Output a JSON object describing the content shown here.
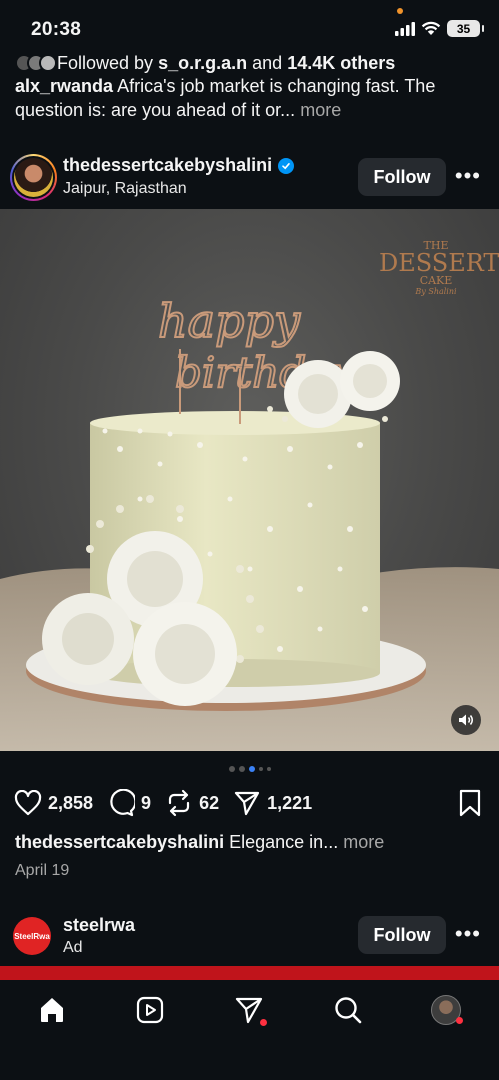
{
  "status": {
    "time": "20:38",
    "battery": "35"
  },
  "prev_post": {
    "followed_prefix": "Followed by",
    "followed_user": "s_o.r.g.a.n",
    "followed_and": "and",
    "followed_count": "14.4K others",
    "caption_user": "alx_rwanda",
    "caption_text": "Africa's job market is changing fast. The question is: are you ahead of it or...",
    "more": "more"
  },
  "post": {
    "username": "thedessertcakebyshalini",
    "location": "Jaipur, Rajasthan",
    "follow_label": "Follow",
    "likes": "2,858",
    "comments": "9",
    "reposts": "62",
    "shares": "1,221",
    "caption_user": "thedessertcakebyshalini",
    "caption_text": "Elegance in...",
    "caption_more": "more",
    "date": "April 19",
    "image_logo": {
      "line1": "THE",
      "line2": "DESSERT",
      "line3": "CAKE",
      "line4": "By Shalini"
    },
    "topper_text": {
      "line1": "happy",
      "line2": "birthday"
    }
  },
  "ad": {
    "username": "steelrwa",
    "label": "Ad",
    "follow_label": "Follow",
    "avatar_text": "SteelRwa"
  },
  "colors": {
    "background": "#0c1014",
    "button": "#262a2f",
    "verified": "#0095f6",
    "notif": "#ff3040",
    "ad_banner": "#c0141b"
  }
}
